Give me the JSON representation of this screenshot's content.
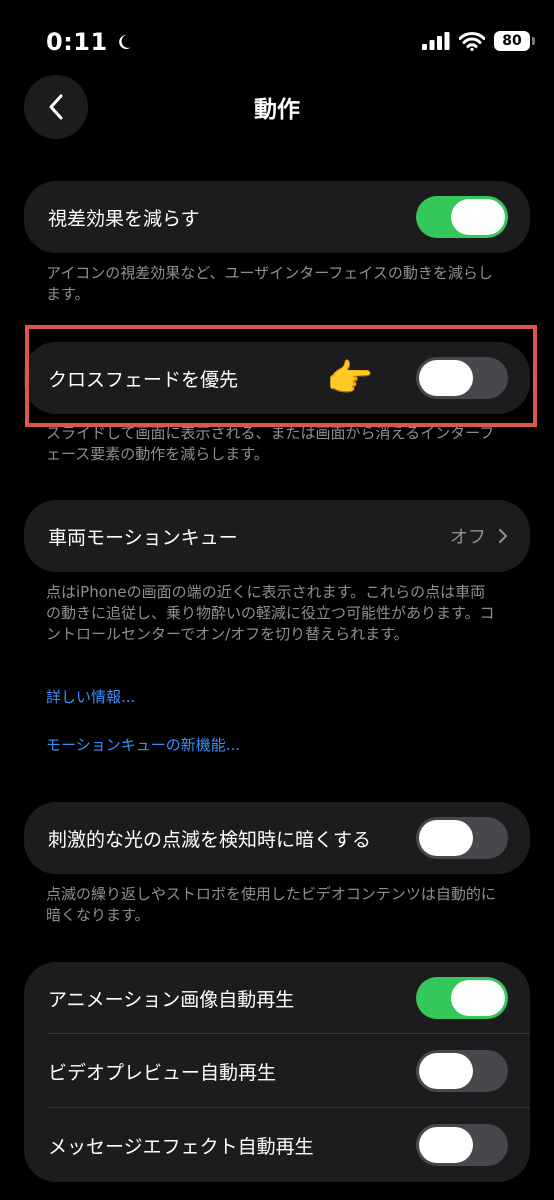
{
  "status_bar": {
    "time": "0:11",
    "battery": "80"
  },
  "nav": {
    "title": "動作"
  },
  "reduce_motion": {
    "label": "視差効果を減らす",
    "on": true,
    "footnote": "アイコンの視差効果など、ユーザインターフェイスの動きを減らします。"
  },
  "crossfade": {
    "label": "クロスフェードを優先",
    "on": false,
    "pointer": "👉",
    "footnote": "スライドして画面に表示される、または画面から消えるインターフェース要素の動作を減らします。"
  },
  "vehicle_motion": {
    "label": "車両モーションキュー",
    "value": "オフ",
    "footnote": "点はiPhoneの画面の端の近くに表示されます。これらの点は車両の動きに追従し、乗り物酔いの軽減に役立つ可能性があります。コントロールセンターでオン/オフを切り替えられます。",
    "link_more": "詳しい情報...",
    "link_new": "モーションキューの新機能..."
  },
  "dim_flashing": {
    "label": "刺激的な光の点滅を検知時に暗くする",
    "on": false,
    "footnote": "点滅の繰り返しやストロボを使用したビデオコンテンツは自動的に暗くなります。"
  },
  "autoplay": {
    "items": [
      {
        "label": "アニメーション画像自動再生",
        "on": true
      },
      {
        "label": "ビデオプレビュー自動再生",
        "on": false
      },
      {
        "label": "メッセージエフェクト自動再生",
        "on": false
      }
    ]
  },
  "colors": {
    "toggle_on": "#34c759",
    "toggle_off": "#48484c",
    "link": "#3a8eff",
    "highlight": "#d9584e"
  }
}
